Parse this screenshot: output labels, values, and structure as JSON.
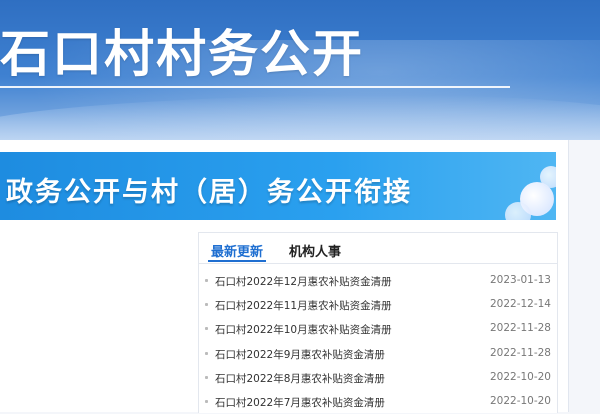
{
  "header": {
    "title": "石口村村务公开"
  },
  "banner": {
    "text": "政务公开与村（居）务公开衔接"
  },
  "news": {
    "tabs": [
      {
        "label": "最新更新",
        "active": true
      },
      {
        "label": "机构人事",
        "active": false
      }
    ],
    "items": [
      {
        "title": "石口村2022年12月惠农补贴资金清册",
        "date": "2023-01-13"
      },
      {
        "title": "石口村2022年11月惠农补贴资金清册",
        "date": "2022-12-14"
      },
      {
        "title": "石口村2022年10月惠农补贴资金清册",
        "date": "2022-11-28"
      },
      {
        "title": "石口村2022年9月惠农补贴资金清册",
        "date": "2022-11-28"
      },
      {
        "title": "石口村2022年8月惠农补贴资金清册",
        "date": "2022-10-20"
      },
      {
        "title": "石口村2022年7月惠农补贴资金清册",
        "date": "2022-10-20"
      }
    ]
  },
  "colors": {
    "accent": "#1f6fd1",
    "banner": "#2aa0ef",
    "hero": "#3f81d1"
  }
}
